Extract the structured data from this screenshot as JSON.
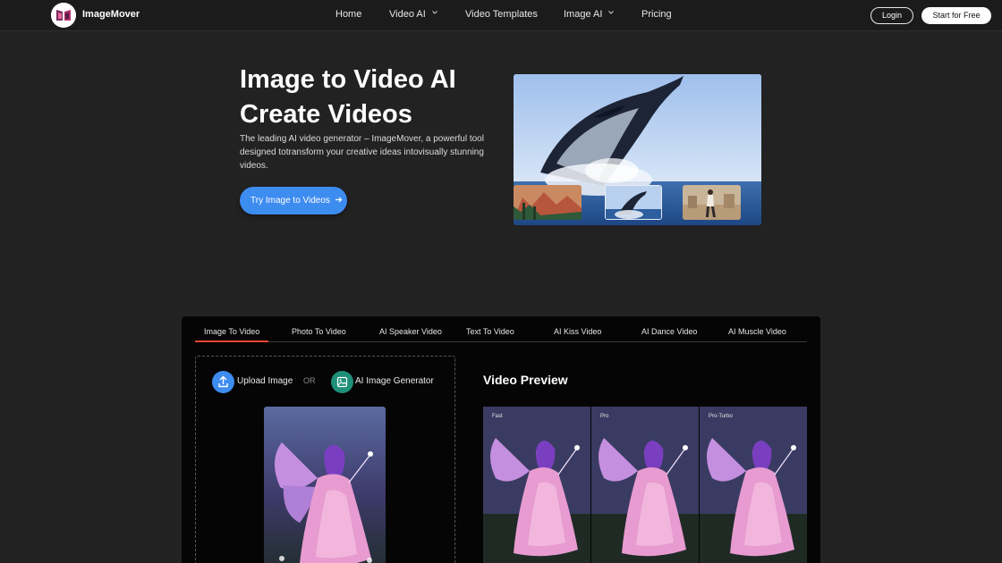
{
  "nav": {
    "brand": "ImageMover",
    "links": [
      {
        "label": "Home",
        "dropdown": false
      },
      {
        "label": "Video AI",
        "dropdown": true
      },
      {
        "label": "Video Templates",
        "dropdown": false
      },
      {
        "label": "Image AI",
        "dropdown": true
      },
      {
        "label": "Pricing",
        "dropdown": false
      }
    ],
    "login": "Login",
    "start": "Start for Free"
  },
  "hero": {
    "title_line1": "Image to Video AI",
    "title_line2": "Create Videos",
    "description": "The leading AI video generator – ImageMover, a powerful tool designed totransform your creative ideas intovisually stunning videos.",
    "cta": "Try Image to Videos"
  },
  "tool": {
    "tabs": [
      "Image To Video",
      "Photo To Video",
      "AI Speaker Video",
      "Text To Video",
      "AI Kiss Video",
      "AI Dance Video",
      "AI Muscle Video"
    ],
    "active_tab": "Image To Video",
    "upload_label": "Upload Image",
    "or_label": "OR",
    "generator_label": "AI Image Generator",
    "preview_title": "Video Preview",
    "preview_tags": [
      "Fast",
      "Pro",
      "Pro-Turbo"
    ]
  },
  "colors": {
    "accent_blue": "#3d8cf0",
    "tab_active": "#e8452e",
    "generator_green": "#1f8f78"
  },
  "icons": {
    "upload": "upload-icon",
    "generator": "image-icon",
    "cta_arrow": "arrow-right-icon",
    "dropdown": "chevron-down-icon"
  }
}
